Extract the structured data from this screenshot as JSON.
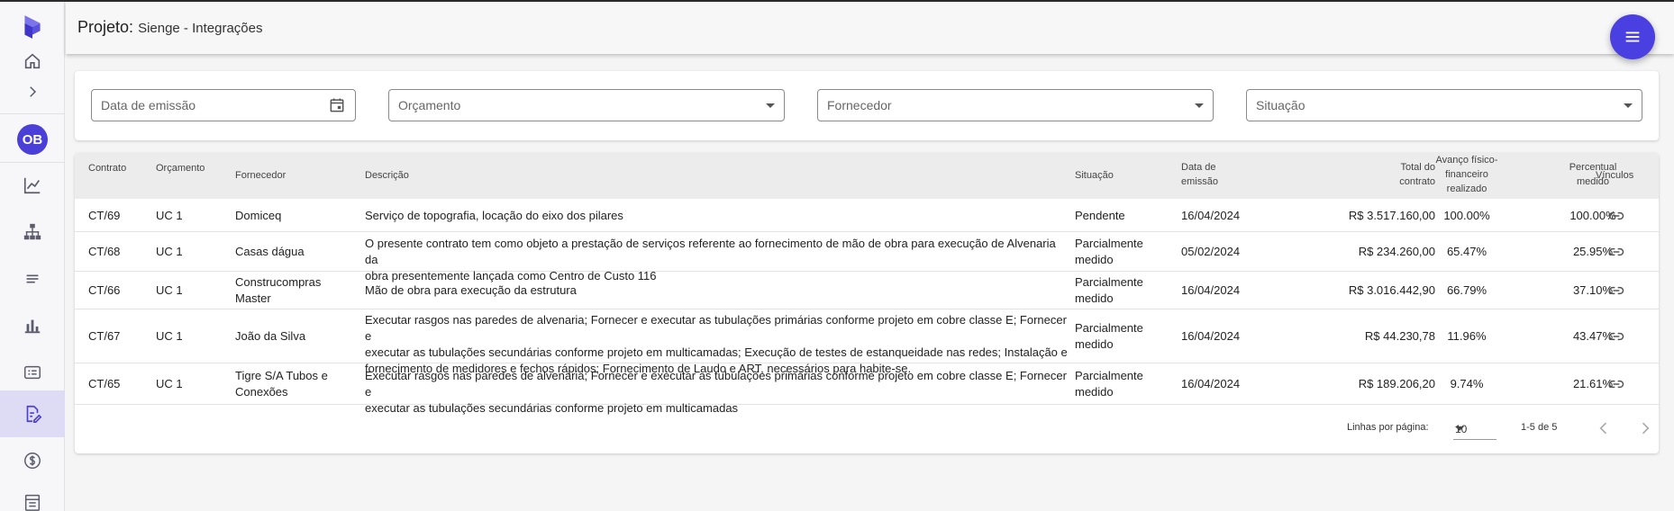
{
  "header": {
    "project_label": "Projeto:",
    "project_name": "Sienge - Integrações"
  },
  "sidebar": {
    "avatar_initials": "OB",
    "items": [
      {
        "icon": "home-icon"
      },
      {
        "icon": "chevron-right-icon"
      },
      {
        "icon": "line-chart-icon"
      },
      {
        "icon": "org-chart-icon"
      },
      {
        "icon": "lines-icon"
      },
      {
        "icon": "bar-chart-icon"
      },
      {
        "icon": "card-list-icon"
      },
      {
        "icon": "contract-edit-icon",
        "active": true
      },
      {
        "icon": "dollar-icon"
      },
      {
        "icon": "document-icon"
      }
    ]
  },
  "filters": {
    "date_placeholder": "Data de emissão",
    "budget_placeholder": "Orçamento",
    "supplier_placeholder": "Fornecedor",
    "status_placeholder": "Situação"
  },
  "table": {
    "headers": {
      "contrato": "Contrato",
      "orcamento": "Orçamento",
      "fornecedor": "Fornecedor",
      "descricao": "Descrição",
      "situacao": "Situação",
      "data_emissao": [
        "Data de",
        "emissão"
      ],
      "total": [
        "Total do",
        "contrato"
      ],
      "avanco": [
        "Avanço físico-",
        "financeiro",
        "realizado"
      ],
      "percentual": [
        "Percentual",
        "medido"
      ],
      "vinculos": "Vínculos"
    },
    "rows": [
      {
        "contrato": "CT/69",
        "orcamento": "UC 1",
        "fornecedor": [
          "Domiceq"
        ],
        "descricao": [
          "Serviço de topografia, locação do eixo dos pilares"
        ],
        "situacao": [
          "Pendente"
        ],
        "data": "16/04/2024",
        "total": "R$ 3.517.160,00",
        "avanco": "100.00%",
        "percentual": "100.00%"
      },
      {
        "contrato": "CT/68",
        "orcamento": "UC 1",
        "fornecedor": [
          "Casas dágua"
        ],
        "descricao": [
          "O presente contrato tem como objeto a prestação de serviços referente ao fornecimento de mão de obra para execução de Alvenaria da",
          "obra presentemente lançada como Centro de Custo 116"
        ],
        "situacao": [
          "Parcialmente",
          "medido"
        ],
        "data": "05/02/2024",
        "total": "R$ 234.260,00",
        "avanco": "65.47%",
        "percentual": "25.95%"
      },
      {
        "contrato": "CT/66",
        "orcamento": "UC 1",
        "fornecedor": [
          "Construcompras",
          "Master"
        ],
        "descricao": [
          "Mão de obra para execução da estrutura"
        ],
        "situacao": [
          "Parcialmente",
          "medido"
        ],
        "data": "16/04/2024",
        "total": "R$ 3.016.442,90",
        "avanco": "66.79%",
        "percentual": "37.10%"
      },
      {
        "contrato": "CT/67",
        "orcamento": "UC 1",
        "fornecedor": [
          "João da Silva"
        ],
        "descricao": [
          "Executar rasgos nas paredes de alvenaria; Fornecer e executar as tubulações primárias conforme projeto em cobre classe E; Fornecer e",
          "executar as tubulações secundárias conforme projeto em multicamadas; Execução de testes de estanqueidade nas redes; Instalação e",
          "fornecimento de medidores e fechos rápidos; Fornecimento de Laudo e ART, necessários para habite-se."
        ],
        "situacao": [
          "Parcialmente",
          "medido"
        ],
        "data": "16/04/2024",
        "total": "R$ 44.230,78",
        "avanco": "11.96%",
        "percentual": "43.47%"
      },
      {
        "contrato": "CT/65",
        "orcamento": "UC 1",
        "fornecedor": [
          "Tigre S/A Tubos e",
          "Conexões"
        ],
        "descricao": [
          "Executar rasgos nas paredes de alvenaria; Fornecer e executar as tubulações primárias conforme projeto em cobre classe E; Fornecer e",
          "executar as tubulações secundárias conforme projeto em multicamadas"
        ],
        "situacao": [
          "Parcialmente",
          "medido"
        ],
        "data": "16/04/2024",
        "total": "R$ 189.206,20",
        "avanco": "9.74%",
        "percentual": "21.61%"
      }
    ]
  },
  "pagination": {
    "rows_per_page_label": "Linhas por página:",
    "rows_per_page": "10",
    "range": "1-5 de 5"
  },
  "colors": {
    "accent": "#4a3fe0",
    "active_nav": "#dedcf5"
  }
}
